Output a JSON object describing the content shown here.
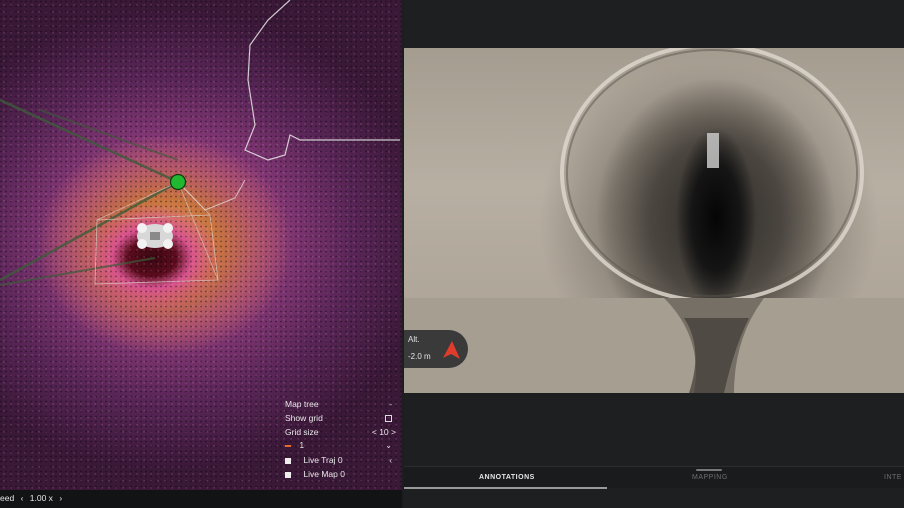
{
  "map_tree": {
    "title": "Map tree",
    "title_caret": "-",
    "show_grid_label": "Show grid",
    "grid_size_label": "Grid size",
    "grid_size_left": "<",
    "grid_size_value": "10",
    "grid_size_right": ">",
    "layer_index": "1",
    "layer_caret": "⌄",
    "live_traj_label": "Live Traj 0",
    "live_traj_caret": "‹",
    "live_map_label": "Live Map 0"
  },
  "speed": {
    "label": "eed",
    "left": "‹",
    "value": "1.00 x",
    "right": "›"
  },
  "altitude": {
    "label": "Alt.",
    "value": "-2.0 m"
  },
  "tabs": {
    "annotations": "ANNOTATIONS",
    "mapping": "MAPPING",
    "inte": "INTE"
  },
  "colors": {
    "trajectory_marker": "#20b830",
    "alt_arrow": "#e03c2c",
    "accent_orange": "#e86a2c"
  }
}
